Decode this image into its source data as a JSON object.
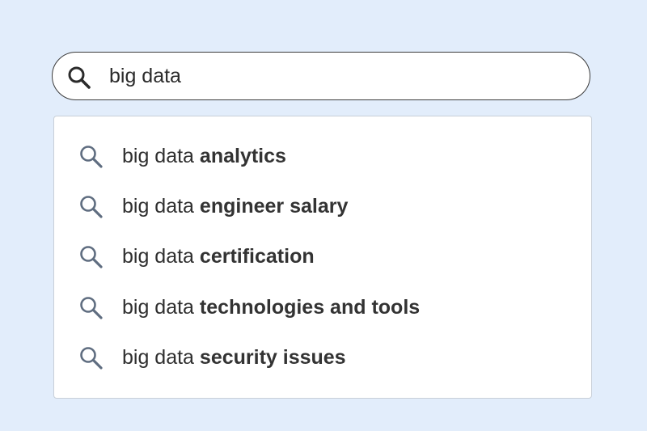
{
  "colors": {
    "background": "#e2edfb",
    "search_bar_border": "#3b3b3b",
    "search_icon_dark": "#2b2b2b",
    "suggestion_icon": "#5f6d80",
    "text": "#2f2f2f"
  },
  "search": {
    "icon": "search-icon",
    "value": "big data"
  },
  "suggestions": [
    {
      "prefix": "big data ",
      "completion": "analytics",
      "icon": "search-icon"
    },
    {
      "prefix": "big data ",
      "completion": "engineer salary",
      "icon": "search-icon"
    },
    {
      "prefix": "big data ",
      "completion": "certification",
      "icon": "search-icon"
    },
    {
      "prefix": "big data ",
      "completion": "technologies and tools",
      "icon": "search-icon"
    },
    {
      "prefix": "big data ",
      "completion": "security issues",
      "icon": "search-icon"
    }
  ]
}
